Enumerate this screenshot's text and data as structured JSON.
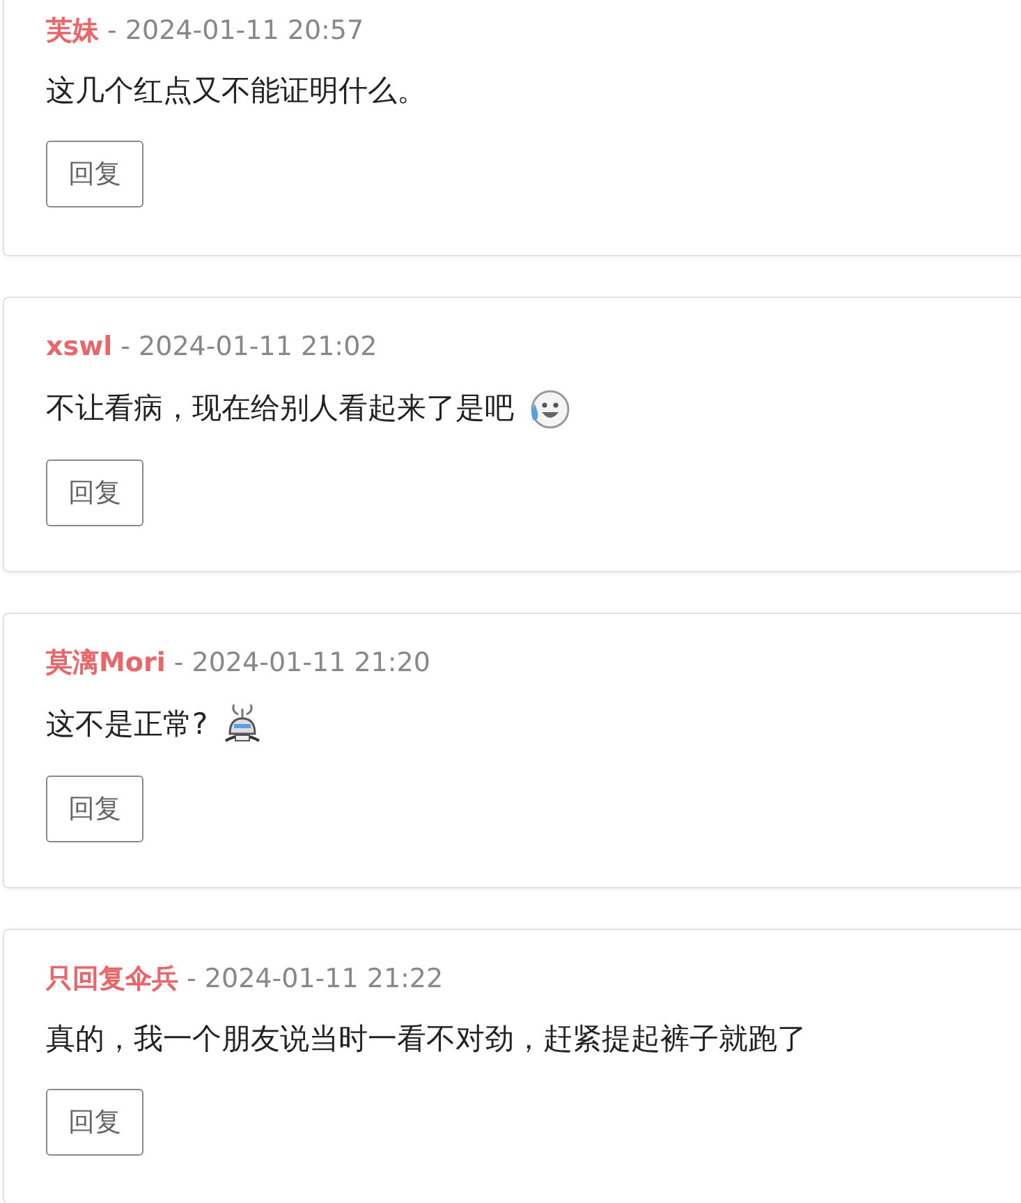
{
  "comments": [
    {
      "kind": "plain",
      "author": "芙妹",
      "date": "- 2024-01-11 20:57",
      "text": "这几个红点又不能证明什么。",
      "reply": "回复"
    },
    {
      "kind": "sweat",
      "author": "xswl",
      "date": "- 2024-01-11 21:02",
      "text": "不让看病，现在给别人看起来了是吧",
      "reply": "回复"
    },
    {
      "kind": "robot",
      "author": "莫漓Mori",
      "date": "- 2024-01-11 21:20",
      "text": "这不是正常?",
      "reply": "回复"
    },
    {
      "kind": "plain",
      "author": "只回复伞兵",
      "date": "- 2024-01-11 21:22",
      "text": "真的，我一个朋友说当时一看不对劲，赶紧提起裤子就跑了",
      "reply": "回复"
    }
  ]
}
